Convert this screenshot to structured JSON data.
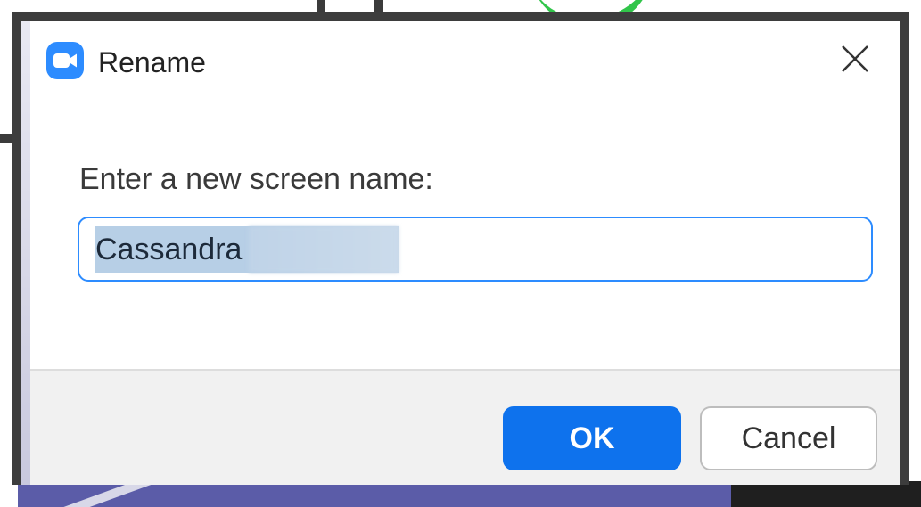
{
  "dialog": {
    "title": "Rename",
    "app_icon": "zoom-camera-icon",
    "close_icon": "close-icon",
    "prompt": "Enter a new screen name:",
    "name_value": "Cassandra",
    "ok_label": "OK",
    "cancel_label": "Cancel"
  },
  "colors": {
    "accent": "#0e72ed",
    "input_focus_border": "#2d8cff",
    "selection": "#b7cfe6",
    "footer_bg": "#f1f1f1"
  }
}
